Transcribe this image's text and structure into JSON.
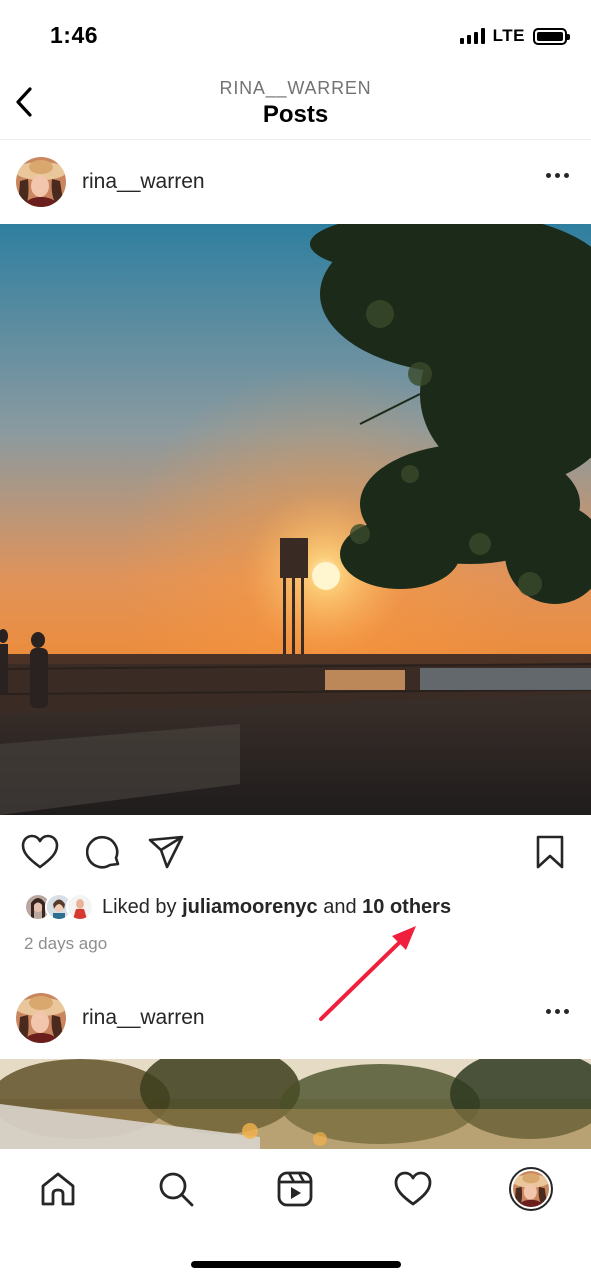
{
  "status_bar": {
    "time": "1:46",
    "network": "LTE"
  },
  "header": {
    "subtitle": "RINA__WARREN",
    "title": "Posts"
  },
  "posts": [
    {
      "username": "rina__warren",
      "likes_prefix": "Liked by ",
      "liked_by": "juliamoorenyc",
      "likes_joiner": " and ",
      "likes_others": "10 others",
      "time_ago": "2 days ago"
    },
    {
      "username": "rina__warren"
    }
  ],
  "icons": {
    "back": "chevron-left-icon",
    "more": "more-horizontal-icon",
    "like": "heart-icon",
    "comment": "comment-icon",
    "share": "send-icon",
    "save": "bookmark-icon",
    "nav": [
      "home-icon",
      "search-icon",
      "reels-icon",
      "activity-heart-icon",
      "profile-avatar"
    ]
  },
  "colors": {
    "annotation_arrow": "#f0203c",
    "text": "#262626",
    "muted": "#8e8e8e"
  }
}
